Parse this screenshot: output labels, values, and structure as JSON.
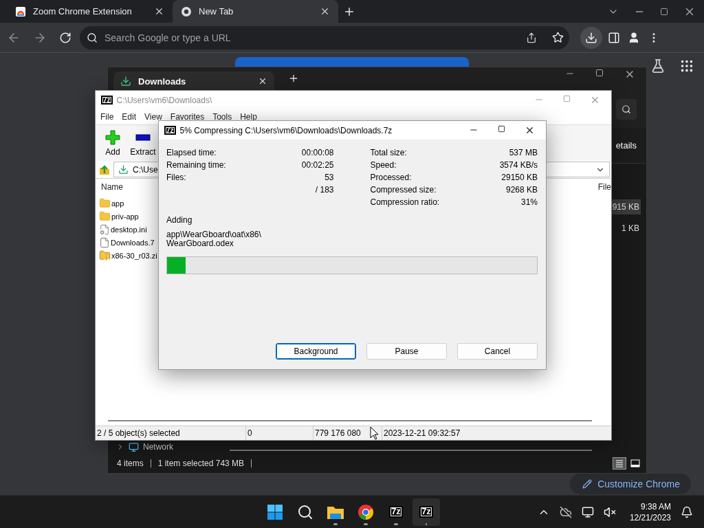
{
  "browser": {
    "tabs": [
      {
        "title": "Zoom Chrome Extension",
        "kind": "extension",
        "selected": false
      },
      {
        "title": "New Tab",
        "kind": "chrome",
        "selected": true
      }
    ],
    "address_placeholder": "Search Google or type a URL",
    "customize_button": "Customize Chrome"
  },
  "explorer": {
    "tab": "Downloads",
    "command_text": "etails",
    "rows": [
      {
        "size": "915 KB",
        "selected": true
      },
      {
        "size": "1 KB",
        "selected": false
      }
    ],
    "nav_item": "Network",
    "status": [
      "4 items",
      "1 item selected  743 MB"
    ]
  },
  "sevenzip": {
    "logo": "7z",
    "title": "C:\\Users\\vm6\\Downloads\\",
    "menu": [
      "File",
      "Edit",
      "View",
      "Favorites",
      "Tools",
      "Help"
    ],
    "toolbar": [
      {
        "label": "Add",
        "kind": "add"
      },
      {
        "label": "Extract",
        "kind": "extract"
      }
    ],
    "path": "C:\\Use",
    "columns": [
      "Name",
      "File"
    ],
    "files": [
      {
        "name": "app",
        "kind": "folder"
      },
      {
        "name": "priv-app",
        "kind": "folder"
      },
      {
        "name": "desktop.ini",
        "kind": "settings"
      },
      {
        "name": "Downloads.7",
        "kind": "file"
      },
      {
        "name": "x86-30_r03.zi",
        "kind": "zip"
      }
    ],
    "status": [
      "2 / 5 object(s) selected",
      "0",
      "779 176 080",
      "2023-12-21 09:32:57"
    ]
  },
  "progress_dialog": {
    "logo": "7z",
    "title": "5% Compressing C:\\Users\\vm6\\Downloads\\Downloads.7z",
    "left_stats": [
      {
        "label": "Elapsed time:",
        "value": "00:00:08"
      },
      {
        "label": "Remaining time:",
        "value": "00:02:25"
      },
      {
        "label": "Files:",
        "value": "53"
      },
      {
        "value": "/ 183"
      }
    ],
    "right_stats": [
      {
        "label": "Total size:",
        "value": "537 MB"
      },
      {
        "label": "Speed:",
        "value": "3574 KB/s"
      },
      {
        "label": "Processed:",
        "value": "29150 KB"
      },
      {
        "label": "Compressed size:",
        "value": "9268 KB"
      },
      {
        "label": "Compression ratio:",
        "value": "31%"
      }
    ],
    "action": "Adding",
    "file_lines": [
      "app\\WearGboard\\oat\\x86\\",
      "WearGboard.odex"
    ],
    "level": 0.05,
    "buttons": [
      {
        "label": "Background",
        "selected": true
      },
      {
        "label": "Pause",
        "selected": false
      },
      {
        "label": "Cancel",
        "selected": false
      }
    ]
  },
  "taskbar": {
    "apps": [
      {
        "kind": "start",
        "running": false,
        "active": false
      },
      {
        "kind": "search",
        "running": false,
        "active": false
      },
      {
        "kind": "files",
        "running": true,
        "active": false
      },
      {
        "kind": "browser",
        "running": true,
        "active": false
      },
      {
        "kind": "archiver",
        "label": "7z",
        "running": true,
        "active": false
      },
      {
        "kind": "archiver",
        "label": "7z",
        "running": true,
        "active": true
      }
    ],
    "time": "9:38 AM",
    "date": "12/21/2023"
  }
}
